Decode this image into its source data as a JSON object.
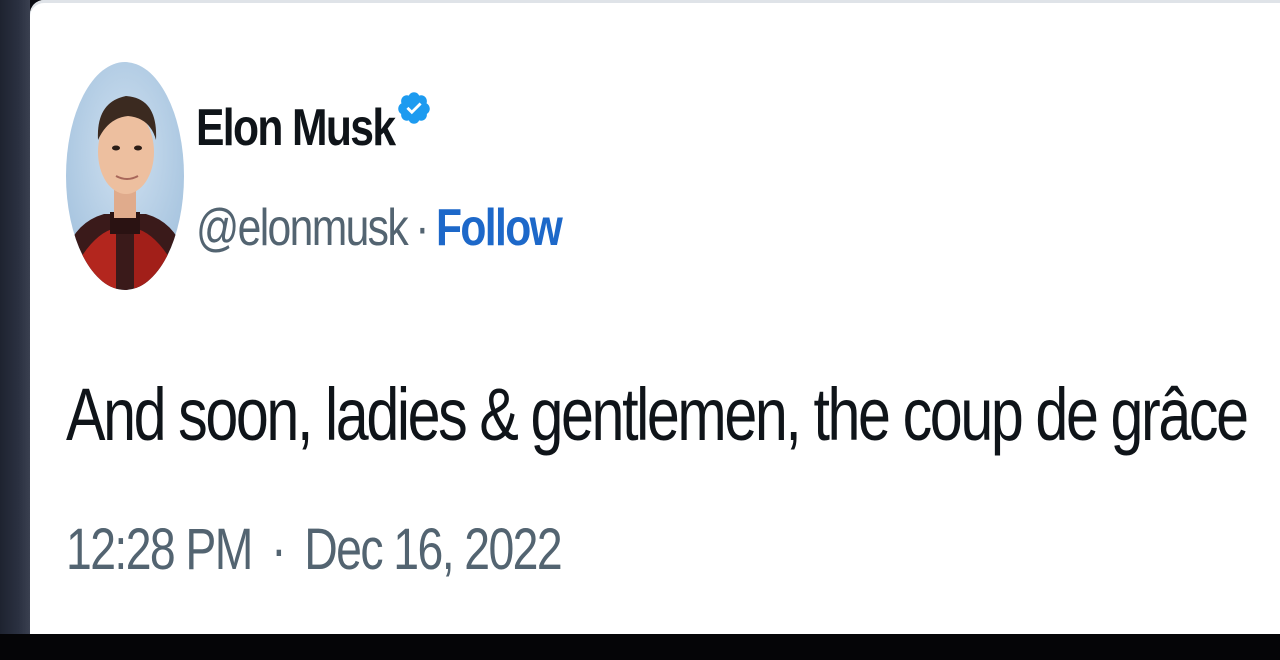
{
  "tweet": {
    "author": {
      "display_name": "Elon Musk",
      "handle": "@elonmusk",
      "verified": true,
      "avatar": "profile-photo"
    },
    "separator": "·",
    "follow_label": "Follow",
    "text": "And soon, ladies & gentlemen, the coup de grâce",
    "time": "12:28 PM",
    "date": "Dec 16, 2022"
  },
  "colors": {
    "text_primary": "#0f1419",
    "text_secondary": "#536471",
    "link": "#1d68c9",
    "verified": "#1d9bf0",
    "card_background": "#ffffff"
  },
  "icons": {
    "verified": "verified-badge-icon"
  }
}
